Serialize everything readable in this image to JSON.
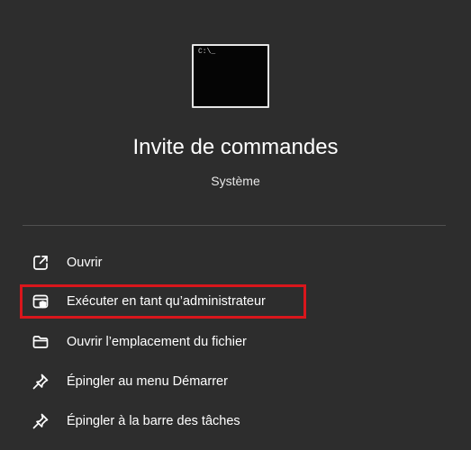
{
  "app": {
    "icon": "command-prompt-icon",
    "prompt_glyph": "C:\\_",
    "title": "Invite de commandes",
    "subtitle": "Système"
  },
  "menu": {
    "items": [
      {
        "label": "Ouvrir",
        "icon": "open-external-icon"
      },
      {
        "label": "Exécuter en tant qu’administrateur",
        "icon": "shield-admin-icon",
        "highlighted": true
      },
      {
        "label": "Ouvrir l’emplacement du fichier",
        "icon": "folder-icon"
      },
      {
        "label": "Épingler au menu Démarrer",
        "icon": "pin-icon"
      },
      {
        "label": "Épingler à la barre des tâches",
        "icon": "pin-icon"
      }
    ]
  },
  "colors": {
    "background": "#2d2d2d",
    "highlight_border": "#d9161c",
    "text": "#ffffff"
  }
}
